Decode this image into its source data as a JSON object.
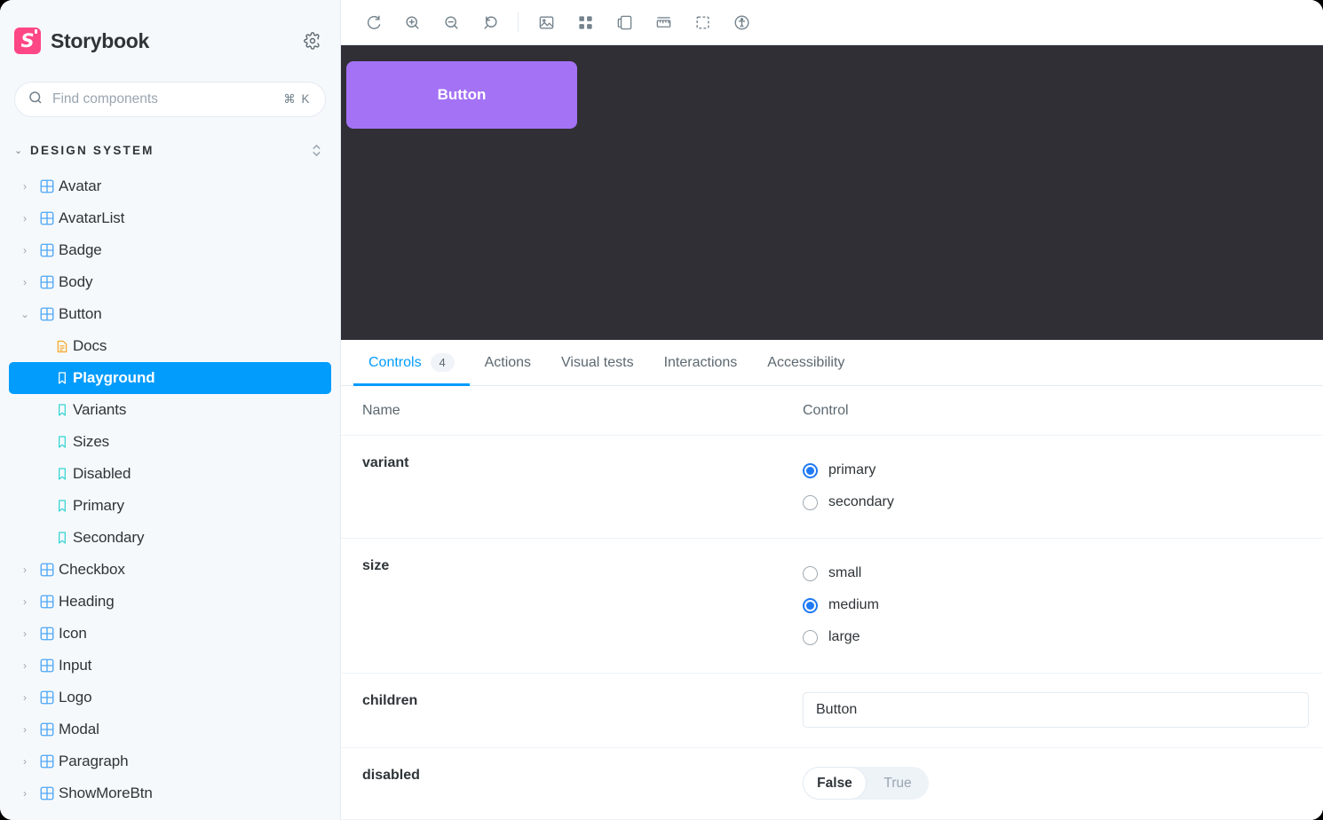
{
  "app": {
    "brand": "Storybook",
    "logo_color": "#ff4785",
    "accent_color": "#029cfd"
  },
  "sidebar": {
    "search": {
      "placeholder": "Find components",
      "shortcut": "⌘ K",
      "value": ""
    },
    "group": {
      "label": "DESIGN SYSTEM",
      "caret": "⌄"
    },
    "items": [
      {
        "label": "Avatar",
        "type": "component",
        "expanded": false,
        "caret": "›"
      },
      {
        "label": "AvatarList",
        "type": "component",
        "expanded": false,
        "caret": "›"
      },
      {
        "label": "Badge",
        "type": "component",
        "expanded": false,
        "caret": "›"
      },
      {
        "label": "Body",
        "type": "component",
        "expanded": false,
        "caret": "›"
      },
      {
        "label": "Button",
        "type": "component",
        "expanded": true,
        "caret": "⌄"
      },
      {
        "label": "Docs",
        "type": "docs",
        "selected": false
      },
      {
        "label": "Playground",
        "type": "story",
        "selected": true
      },
      {
        "label": "Variants",
        "type": "story",
        "selected": false
      },
      {
        "label": "Sizes",
        "type": "story",
        "selected": false
      },
      {
        "label": "Disabled",
        "type": "story",
        "selected": false
      },
      {
        "label": "Primary",
        "type": "story",
        "selected": false
      },
      {
        "label": "Secondary",
        "type": "story",
        "selected": false
      },
      {
        "label": "Checkbox",
        "type": "component",
        "expanded": false,
        "caret": "›"
      },
      {
        "label": "Heading",
        "type": "component",
        "expanded": false,
        "caret": "›"
      },
      {
        "label": "Icon",
        "type": "component",
        "expanded": false,
        "caret": "›"
      },
      {
        "label": "Input",
        "type": "component",
        "expanded": false,
        "caret": "›"
      },
      {
        "label": "Logo",
        "type": "component",
        "expanded": false,
        "caret": "›"
      },
      {
        "label": "Modal",
        "type": "component",
        "expanded": false,
        "caret": "›"
      },
      {
        "label": "Paragraph",
        "type": "component",
        "expanded": false,
        "caret": "›"
      },
      {
        "label": "ShowMoreBtn",
        "type": "component",
        "expanded": false,
        "caret": "›"
      }
    ]
  },
  "toolbar": {
    "buttons": [
      {
        "name": "remount-icon",
        "title": "Remount component"
      },
      {
        "name": "zoom-in-icon",
        "title": "Zoom in"
      },
      {
        "name": "zoom-out-icon",
        "title": "Zoom out"
      },
      {
        "name": "zoom-reset-icon",
        "title": "Reset zoom"
      },
      {
        "name": "backgrounds-icon",
        "title": "Change background"
      },
      {
        "name": "grid-icon",
        "title": "Apply a grid"
      },
      {
        "name": "viewport-icon",
        "title": "Change viewport"
      },
      {
        "name": "measure-icon",
        "title": "Enable measure"
      },
      {
        "name": "outline-icon",
        "title": "Apply outlines"
      },
      {
        "name": "accessibility-icon",
        "title": "Accessibility"
      }
    ]
  },
  "preview": {
    "button_label": "Button",
    "button_color": "#a472f5",
    "canvas_color": "#2f2f35"
  },
  "panel": {
    "tabs": [
      {
        "label": "Controls",
        "badge": "4",
        "active": true
      },
      {
        "label": "Actions",
        "badge": "",
        "active": false
      },
      {
        "label": "Visual tests",
        "badge": "",
        "active": false
      },
      {
        "label": "Interactions",
        "badge": "",
        "active": false
      },
      {
        "label": "Accessibility",
        "badge": "",
        "active": false
      }
    ],
    "columns": {
      "name": "Name",
      "control": "Control"
    },
    "controls": [
      {
        "name": "variant",
        "type": "radio",
        "options": [
          {
            "label": "primary",
            "checked": true
          },
          {
            "label": "secondary",
            "checked": false
          }
        ]
      },
      {
        "name": "size",
        "type": "radio",
        "options": [
          {
            "label": "small",
            "checked": false
          },
          {
            "label": "medium",
            "checked": true
          },
          {
            "label": "large",
            "checked": false
          }
        ]
      },
      {
        "name": "children",
        "type": "text",
        "value": "Button"
      },
      {
        "name": "disabled",
        "type": "boolean",
        "false_label": "False",
        "true_label": "True",
        "value": false
      }
    ]
  }
}
